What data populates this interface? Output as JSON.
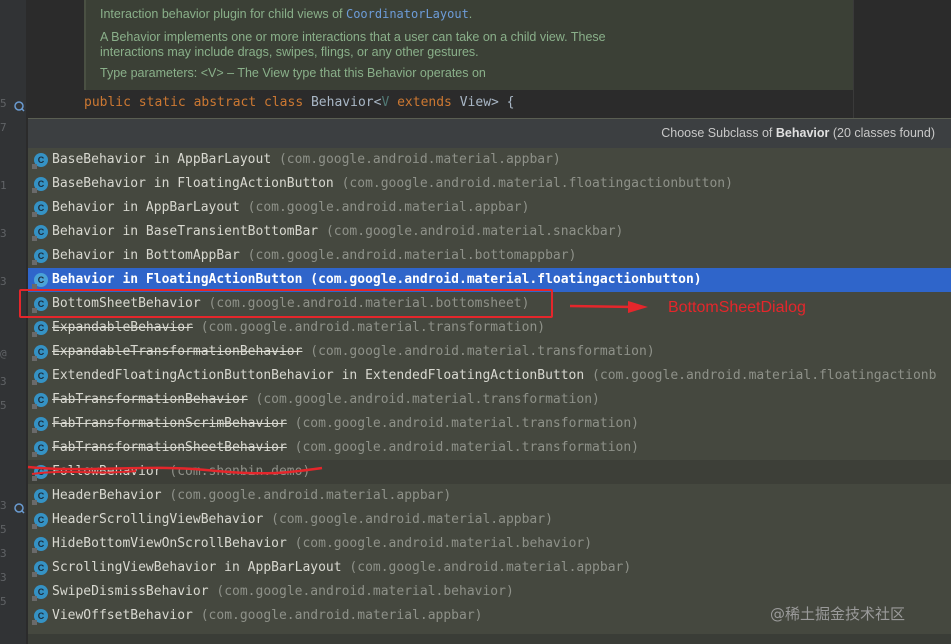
{
  "editor": {
    "gutter_numbers": [
      "5",
      "7",
      "1",
      "3",
      "3",
      "1",
      "1",
      "3",
      "@",
      "3",
      "5",
      "7",
      "3",
      "3",
      "5",
      "3",
      "3",
      "5"
    ],
    "javadoc": {
      "line1_prefix": "Interaction behavior plugin for child views of ",
      "line1_link": "CoordinatorLayout",
      "line1_suffix": ".",
      "line2": "A Behavior implements one or more interactions that a user can take on a child view. These",
      "line3": "interactions may include drags, swipes, flings, or any other gestures.",
      "line4": "Type parameters: <V> – The View type that this Behavior operates on"
    },
    "code_line": {
      "kw1": "public static abstract class",
      "name": " Behavior<",
      "type_param": "V",
      "kw2": " extends",
      "rest": " View> {"
    }
  },
  "popup": {
    "header_prefix": "Choose Subclass of ",
    "header_class": "Behavior",
    "header_suffix": " (20 classes found)",
    "items": [
      {
        "name": "BaseBehavior in AppBarLayout",
        "pkg": "(com.google.android.material.appbar)",
        "strike": false,
        "selected": false
      },
      {
        "name": "BaseBehavior in FloatingActionButton",
        "pkg": "(com.google.android.material.floatingactionbutton)",
        "strike": false,
        "selected": false
      },
      {
        "name": "Behavior in AppBarLayout",
        "pkg": "(com.google.android.material.appbar)",
        "strike": false,
        "selected": false
      },
      {
        "name": "Behavior in BaseTransientBottomBar",
        "pkg": "(com.google.android.material.snackbar)",
        "strike": false,
        "selected": false
      },
      {
        "name": "Behavior in BottomAppBar",
        "pkg": "(com.google.android.material.bottomappbar)",
        "strike": false,
        "selected": false
      },
      {
        "name": "Behavior in FloatingActionButton",
        "pkg": "(com.google.android.material.floatingactionbutton)",
        "strike": false,
        "selected": true
      },
      {
        "name": "BottomSheetBehavior",
        "pkg": "(com.google.android.material.bottomsheet)",
        "strike": false,
        "selected": false
      },
      {
        "name": "ExpandableBehavior",
        "pkg": "(com.google.android.material.transformation)",
        "strike": true,
        "selected": false
      },
      {
        "name": "ExpandableTransformationBehavior",
        "pkg": "(com.google.android.material.transformation)",
        "strike": true,
        "selected": false
      },
      {
        "name": "ExtendedFloatingActionButtonBehavior in ExtendedFloatingActionButton",
        "pkg": "(com.google.android.material.floatingactionb",
        "strike": false,
        "selected": false
      },
      {
        "name": "FabTransformationBehavior",
        "pkg": "(com.google.android.material.transformation)",
        "strike": true,
        "selected": false
      },
      {
        "name": "FabTransformationScrimBehavior",
        "pkg": "(com.google.android.material.transformation)",
        "strike": true,
        "selected": false
      },
      {
        "name": "FabTransformationSheetBehavior",
        "pkg": "(com.google.android.material.transformation)",
        "strike": true,
        "selected": false
      },
      {
        "name": "FollowBehavior",
        "pkg": "(com.shenbin.demo)",
        "strike": false,
        "selected": false,
        "hover": true
      },
      {
        "name": "HeaderBehavior",
        "pkg": "(com.google.android.material.appbar)",
        "strike": false,
        "selected": false
      },
      {
        "name": "HeaderScrollingViewBehavior",
        "pkg": "(com.google.android.material.appbar)",
        "strike": false,
        "selected": false
      },
      {
        "name": "HideBottomViewOnScrollBehavior",
        "pkg": "(com.google.android.material.behavior)",
        "strike": false,
        "selected": false
      },
      {
        "name": "ScrollingViewBehavior in AppBarLayout",
        "pkg": "(com.google.android.material.appbar)",
        "strike": false,
        "selected": false
      },
      {
        "name": "SwipeDismissBehavior",
        "pkg": "(com.google.android.material.behavior)",
        "strike": false,
        "selected": false
      },
      {
        "name": "ViewOffsetBehavior",
        "pkg": "(com.google.android.material.appbar)",
        "strike": false,
        "selected": false
      }
    ],
    "icon_letter": "C"
  },
  "annotation": {
    "label": "BottomSheetDialog",
    "color": "#e5262b"
  },
  "watermark": "@稀土掘金技术社区",
  "colors": {
    "selection": "#2f65ca",
    "keyword": "#cc7832",
    "doc_text": "#8ab08a",
    "link": "#6d9cd8"
  }
}
